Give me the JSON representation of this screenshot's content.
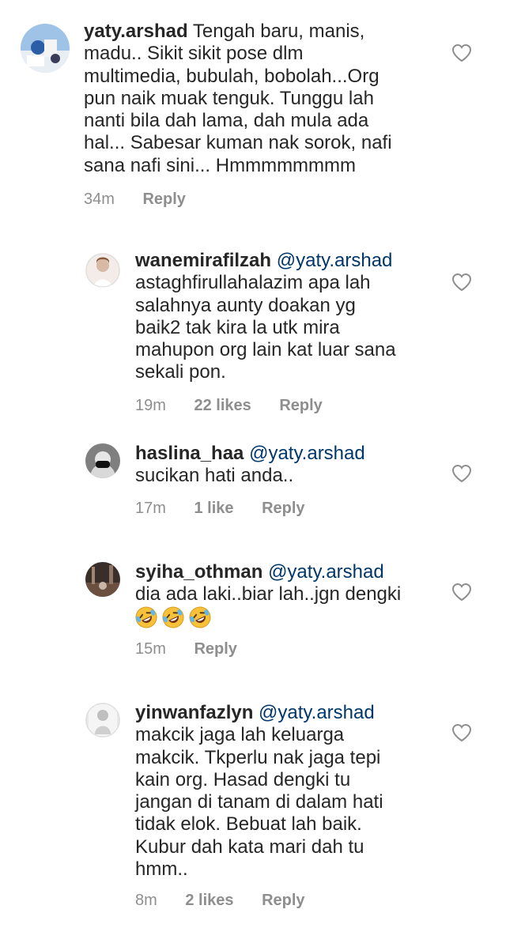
{
  "comments": [
    {
      "username": "yaty.arshad",
      "mention": "",
      "text": "Tengah baru, manis,\nmadu.. Sikit sikit pose dlm\nmultimedia, bubulah, bobolah...Org\npun naik muak tenguk. Tunggu lah\nnanti bila dah lama, dah mula ada\nhal... Sabesar kuman nak sorok, nafi\nsana nafi sini... Hmmmmmmmm",
      "time": "34m",
      "likes": "",
      "reply": "Reply"
    },
    {
      "username": "wanemirafilzah",
      "mention": "@yaty.arshad",
      "text": "astaghfirullahalazim apa lah\nsalahnya aunty doakan yg\nbaik2 tak kira la utk mira\nmahupon org lain kat luar sana\nsekali pon.",
      "time": "19m",
      "likes": "22 likes",
      "reply": "Reply"
    },
    {
      "username": "haslina_haa",
      "mention": "@yaty.arshad",
      "text": "sucikan hati anda..",
      "time": "17m",
      "likes": "1 like",
      "reply": "Reply"
    },
    {
      "username": "syiha_othman",
      "mention": "@yaty.arshad",
      "text": "dia ada laki..biar lah..jgn dengki",
      "emoji": "rolling-on-floor-laughing x3",
      "time": "15m",
      "likes": "",
      "reply": "Reply"
    },
    {
      "username": "yinwanfazlyn",
      "mention": "@yaty.arshad",
      "text": "makcik jaga lah keluarga\nmakcik. Tkperlu nak jaga tepi\nkain org. Hasad dengki tu\njangan di tanam di dalam hati\ntidak elok. Bebuat lah baik.\nKubur dah kata mari dah tu\nhmm..",
      "time": "8m",
      "likes": "2 likes",
      "reply": "Reply"
    }
  ],
  "icons": {
    "like": "heart-outline-icon",
    "emoji": "rolling-on-floor-laughing-emoji"
  },
  "colors": {
    "text": "#262626",
    "meta": "#8e8e8e",
    "mention": "#00376b"
  }
}
